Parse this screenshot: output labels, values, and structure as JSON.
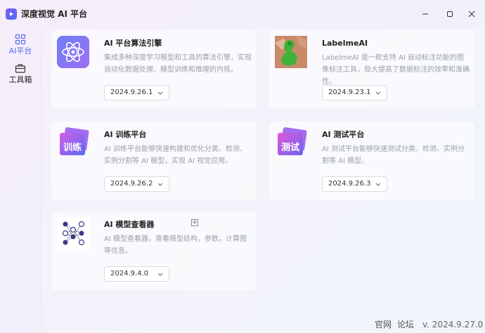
{
  "window": {
    "title": "深度视觉 AI 平台"
  },
  "sidebar": {
    "items": [
      {
        "label": "AI平台",
        "icon": "grid-icon",
        "active": true
      },
      {
        "label": "工具箱",
        "icon": "toolbox-icon",
        "active": false
      }
    ]
  },
  "cards": [
    {
      "title": "AI 平台算法引擎",
      "desc": "集成多种深度学习模型和工具的算法引擎，实现自动化数据处理、模型训练和推理的内核。",
      "version": "2024.9.26.1",
      "icon": "atom-icon"
    },
    {
      "title": "LabelmeAI",
      "desc": "LabelmeAI 是一款支持 AI 自动标注功能的图像标注工具，极大提高了数据标注的效率和准确性。",
      "version": "2024.9.23.1",
      "icon": "labelme-image-icon"
    },
    {
      "title": "AI 训练平台",
      "desc": "AI 训练平台能够快速构建和优化分类、检测、实例分割等 AI 模型，实现 AI 视觉应用。",
      "version": "2024.9.26.2",
      "icon": "train-icon",
      "icon_text": "训练"
    },
    {
      "title": "AI 测试平台",
      "desc": "AI 测试平台能够快速测试分类、检测、实例分割等 AI 模型。",
      "version": "2024.9.26.3",
      "icon": "test-icon",
      "icon_text": "测试"
    },
    {
      "title": "AI 模型查看器",
      "desc": "AI 模型查看器，查看模型结构，参数，计算图等信息。",
      "version": "2024.9.4.0",
      "icon": "model-graph-icon"
    }
  ],
  "footer": {
    "link1": "官网",
    "link2": "论坛",
    "version": "v. 2024.9.27.0"
  },
  "colors": {
    "accent": "#5a6cf0"
  }
}
